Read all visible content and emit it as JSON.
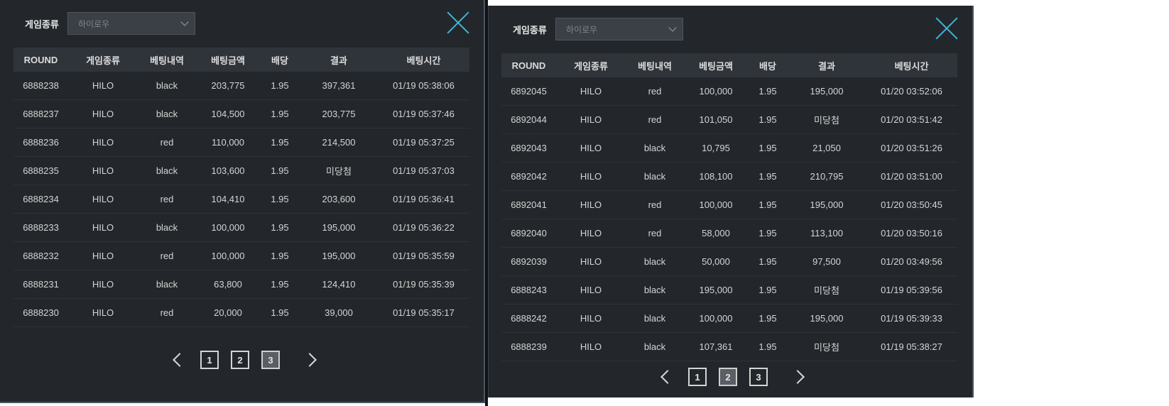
{
  "left": {
    "filter": {
      "label": "게임종류",
      "selected": "하이로우"
    },
    "columns": [
      "ROUND",
      "게임종류",
      "베팅내역",
      "베팅금액",
      "배당",
      "결과",
      "베팅시간"
    ],
    "rows": [
      {
        "round": "6888238",
        "game": "HILO",
        "bet": "black",
        "amount": "203,775",
        "odds": "1.95",
        "result": "397,361",
        "status": "win",
        "time": "01/19 05:38:06"
      },
      {
        "round": "6888237",
        "game": "HILO",
        "bet": "black",
        "amount": "104,500",
        "odds": "1.95",
        "result": "203,775",
        "status": "win",
        "time": "01/19 05:37:46"
      },
      {
        "round": "6888236",
        "game": "HILO",
        "bet": "red",
        "amount": "110,000",
        "odds": "1.95",
        "result": "214,500",
        "status": "win",
        "time": "01/19 05:37:25"
      },
      {
        "round": "6888235",
        "game": "HILO",
        "bet": "black",
        "amount": "103,600",
        "odds": "1.95",
        "result": "미당첨",
        "status": "lose",
        "time": "01/19 05:37:03"
      },
      {
        "round": "6888234",
        "game": "HILO",
        "bet": "red",
        "amount": "104,410",
        "odds": "1.95",
        "result": "203,600",
        "status": "win",
        "time": "01/19 05:36:41"
      },
      {
        "round": "6888233",
        "game": "HILO",
        "bet": "black",
        "amount": "100,000",
        "odds": "1.95",
        "result": "195,000",
        "status": "win",
        "time": "01/19 05:36:22"
      },
      {
        "round": "6888232",
        "game": "HILO",
        "bet": "red",
        "amount": "100,000",
        "odds": "1.95",
        "result": "195,000",
        "status": "win",
        "time": "01/19 05:35:59"
      },
      {
        "round": "6888231",
        "game": "HILO",
        "bet": "black",
        "amount": "63,800",
        "odds": "1.95",
        "result": "124,410",
        "status": "win",
        "time": "01/19 05:35:39"
      },
      {
        "round": "6888230",
        "game": "HILO",
        "bet": "red",
        "amount": "20,000",
        "odds": "1.95",
        "result": "39,000",
        "status": "win",
        "time": "01/19 05:35:17"
      }
    ],
    "pagination": {
      "pages": [
        "1",
        "2",
        "3"
      ],
      "active": "3"
    }
  },
  "right": {
    "filter": {
      "label": "게임종류",
      "selected": "하이로우"
    },
    "columns": [
      "ROUND",
      "게임종류",
      "베팅내역",
      "베팅금액",
      "배당",
      "결과",
      "베팅시간"
    ],
    "rows": [
      {
        "round": "6892045",
        "game": "HILO",
        "bet": "red",
        "amount": "100,000",
        "odds": "1.95",
        "result": "195,000",
        "status": "win",
        "time": "01/20 03:52:06"
      },
      {
        "round": "6892044",
        "game": "HILO",
        "bet": "red",
        "amount": "101,050",
        "odds": "1.95",
        "result": "미당첨",
        "status": "lose",
        "time": "01/20 03:51:42"
      },
      {
        "round": "6892043",
        "game": "HILO",
        "bet": "black",
        "amount": "10,795",
        "odds": "1.95",
        "result": "21,050",
        "status": "win",
        "time": "01/20 03:51:26"
      },
      {
        "round": "6892042",
        "game": "HILO",
        "bet": "black",
        "amount": "108,100",
        "odds": "1.95",
        "result": "210,795",
        "status": "win",
        "time": "01/20 03:51:00"
      },
      {
        "round": "6892041",
        "game": "HILO",
        "bet": "red",
        "amount": "100,000",
        "odds": "1.95",
        "result": "195,000",
        "status": "win",
        "time": "01/20 03:50:45"
      },
      {
        "round": "6892040",
        "game": "HILO",
        "bet": "red",
        "amount": "58,000",
        "odds": "1.95",
        "result": "113,100",
        "status": "win",
        "time": "01/20 03:50:16"
      },
      {
        "round": "6892039",
        "game": "HILO",
        "bet": "black",
        "amount": "50,000",
        "odds": "1.95",
        "result": "97,500",
        "status": "win",
        "time": "01/20 03:49:56"
      },
      {
        "round": "6888243",
        "game": "HILO",
        "bet": "black",
        "amount": "195,000",
        "odds": "1.95",
        "result": "미당첨",
        "status": "lose",
        "time": "01/19 05:39:56"
      },
      {
        "round": "6888242",
        "game": "HILO",
        "bet": "black",
        "amount": "100,000",
        "odds": "1.95",
        "result": "195,000",
        "status": "win",
        "time": "01/19 05:39:33"
      },
      {
        "round": "6888239",
        "game": "HILO",
        "bet": "black",
        "amount": "107,361",
        "odds": "1.95",
        "result": "미당첨",
        "status": "lose",
        "time": "01/19 05:38:27"
      }
    ],
    "pagination": {
      "pages": [
        "1",
        "2",
        "3"
      ],
      "active": "2"
    }
  },
  "colors": {
    "panel_bg": "#23272b",
    "header_bg": "#2f343a",
    "win": "#8ed13c",
    "lose": "#e0333a",
    "close_icon": "#3fb5d6"
  },
  "icons": {
    "close": "close-x-icon",
    "prev": "chevron-left-icon",
    "next": "chevron-right-icon",
    "dropdown": "chevron-down-icon"
  }
}
